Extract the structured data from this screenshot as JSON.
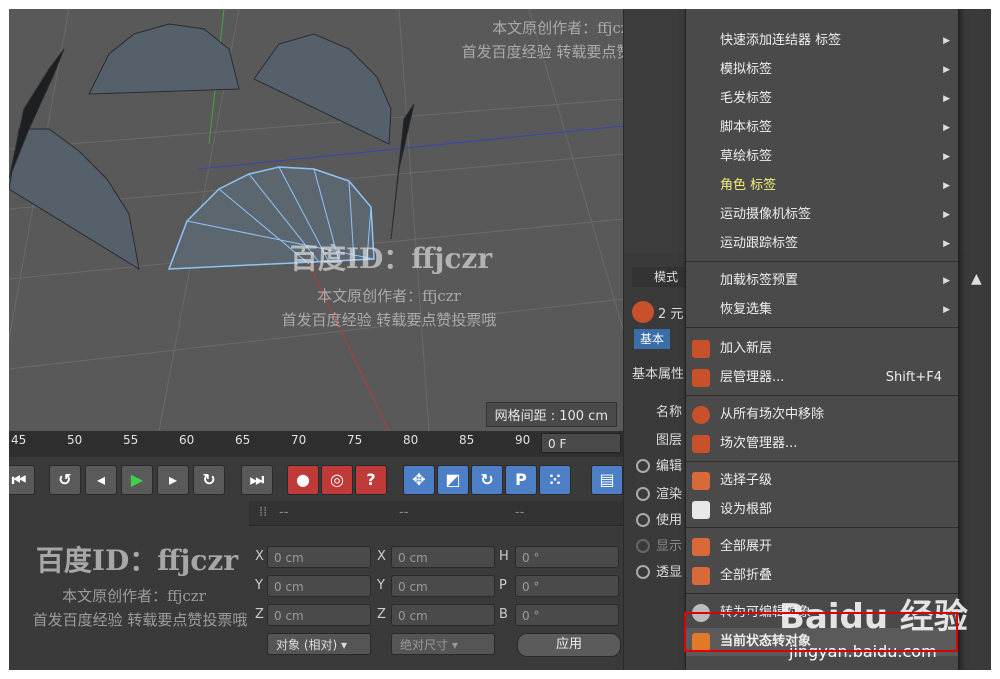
{
  "viewport": {
    "grid_spacing": "网格间距 : 100 cm"
  },
  "timeline": {
    "ticks": [
      "45",
      "50",
      "55",
      "60",
      "65",
      "70",
      "75",
      "80",
      "85",
      "90"
    ],
    "current_frame": "0 F"
  },
  "coordinates": {
    "header": [
      "--",
      "--",
      "--"
    ],
    "rows": [
      {
        "a": "X",
        "a_val": "0 cm",
        "b": "X",
        "b_val": "0 cm",
        "c": "H",
        "c_val": "0 °"
      },
      {
        "a": "Y",
        "a_val": "0 cm",
        "b": "Y",
        "b_val": "0 cm",
        "c": "P",
        "c_val": "0 °"
      },
      {
        "a": "Z",
        "a_val": "0 cm",
        "b": "Z",
        "b_val": "0 cm",
        "c": "B",
        "c_val": "0 °"
      }
    ],
    "mode_dropdown": "对象 (相对)",
    "size_dropdown": "绝对尺寸",
    "apply": "应用"
  },
  "attributes": {
    "head": "模式",
    "object_count": "2 元",
    "tab_basic": "基本",
    "section": "基本属性",
    "labels": [
      "名称",
      "图层",
      "编辑",
      "渲染",
      "使用",
      "显示",
      "透显"
    ]
  },
  "context_menu": {
    "items": [
      {
        "label": "快速添加连结器 标签",
        "submenu": true
      },
      {
        "label": "模拟标签",
        "submenu": true
      },
      {
        "label": "毛发标签",
        "submenu": true
      },
      {
        "label": "脚本标签",
        "submenu": true
      },
      {
        "label": "草绘标签",
        "submenu": true
      },
      {
        "label": "角色 标签",
        "submenu": true,
        "highlight": true
      },
      {
        "label": "运动摄像机标签",
        "submenu": true
      },
      {
        "label": "运动跟踪标签",
        "submenu": true
      },
      {
        "label": "加载标签预置",
        "submenu": true
      },
      {
        "label": "恢复选集",
        "submenu": true
      },
      {
        "label": "加入新层",
        "icon": "layer-add-icon"
      },
      {
        "label": "层管理器...",
        "shortcut": "Shift+F4",
        "icon": "layer-manager-icon"
      },
      {
        "label": "从所有场次中移除",
        "icon": "take-remove-icon"
      },
      {
        "label": "场次管理器...",
        "icon": "take-manager-icon"
      },
      {
        "label": "选择子级",
        "icon": "select-children-icon"
      },
      {
        "label": "设为根部",
        "icon": "set-root-icon"
      },
      {
        "label": "全部展开",
        "icon": "expand-all-icon"
      },
      {
        "label": "全部折叠",
        "icon": "collapse-all-icon"
      },
      {
        "label": "转为可编辑对象",
        "icon": "make-editable-icon"
      },
      {
        "label": "当前状态转对象",
        "icon": "current-state-icon"
      }
    ]
  },
  "watermarks": {
    "id": "百度ID：ffjczr",
    "author": "本文原创作者：ffjczr",
    "note": "首发百度经验 转载要点赞投票哦"
  },
  "baidu": {
    "logo": "Baidu 经验",
    "url": "jingyan.baidu.com"
  }
}
